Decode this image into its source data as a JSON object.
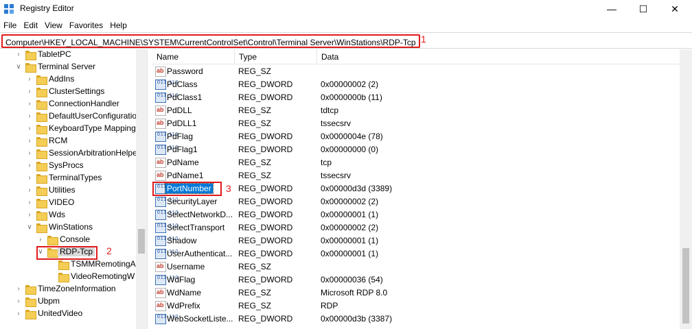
{
  "window": {
    "title": "Registry Editor",
    "controls": {
      "minimize": "—",
      "maximize": "☐",
      "close": "✕"
    }
  },
  "menu": [
    "File",
    "Edit",
    "View",
    "Favorites",
    "Help"
  ],
  "address": {
    "path": "Computer\\HKEY_LOCAL_MACHINE\\SYSTEM\\CurrentControlSet\\Control\\Terminal Server\\WinStations\\RDP-Tcp",
    "callout": "1"
  },
  "tree": {
    "items": [
      {
        "label": "TabletPC",
        "expanded": false,
        "selected": false
      },
      {
        "label": "Terminal Server",
        "expanded": true,
        "selected": false
      },
      {
        "label": "AddIns",
        "expanded": false,
        "selected": false
      },
      {
        "label": "ClusterSettings",
        "expanded": false,
        "selected": false
      },
      {
        "label": "ConnectionHandler",
        "expanded": false,
        "selected": false
      },
      {
        "label": "DefaultUserConfiguratio",
        "expanded": false,
        "selected": false
      },
      {
        "label": "KeyboardType Mapping",
        "expanded": false,
        "selected": false
      },
      {
        "label": "RCM",
        "expanded": false,
        "selected": false
      },
      {
        "label": "SessionArbitrationHelpe",
        "expanded": false,
        "selected": false
      },
      {
        "label": "SysProcs",
        "expanded": false,
        "selected": false
      },
      {
        "label": "TerminalTypes",
        "expanded": false,
        "selected": false
      },
      {
        "label": "Utilities",
        "expanded": false,
        "selected": false
      },
      {
        "label": "VIDEO",
        "expanded": false,
        "selected": false
      },
      {
        "label": "Wds",
        "expanded": false,
        "selected": false
      },
      {
        "label": "WinStations",
        "expanded": true,
        "selected": false
      },
      {
        "label": "Console",
        "expanded": false,
        "selected": false
      },
      {
        "label": "RDP-Tcp",
        "expanded": true,
        "selected": true
      },
      {
        "label": "TSMMRemotingA",
        "expanded": false,
        "selected": false
      },
      {
        "label": "VideoRemotingW",
        "expanded": false,
        "selected": false
      },
      {
        "label": "TimeZoneInformation",
        "expanded": false,
        "selected": false
      },
      {
        "label": "Ubpm",
        "expanded": false,
        "selected": false
      },
      {
        "label": "UnitedVideo",
        "expanded": false,
        "selected": false
      }
    ],
    "callout": "2"
  },
  "list": {
    "columns": [
      "Name",
      "Type",
      "Data"
    ],
    "rows": [
      {
        "name": "Password",
        "type": "REG_SZ",
        "data": "",
        "icon": "string-value-icon"
      },
      {
        "name": "PdClass",
        "type": "REG_DWORD",
        "data": "0x00000002 (2)",
        "icon": "binary-value-icon"
      },
      {
        "name": "PdClass1",
        "type": "REG_DWORD",
        "data": "0x0000000b (11)",
        "icon": "binary-value-icon"
      },
      {
        "name": "PdDLL",
        "type": "REG_SZ",
        "data": "tdtcp",
        "icon": "string-value-icon"
      },
      {
        "name": "PdDLL1",
        "type": "REG_SZ",
        "data": "tssecsrv",
        "icon": "string-value-icon"
      },
      {
        "name": "PdFlag",
        "type": "REG_DWORD",
        "data": "0x0000004e (78)",
        "icon": "binary-value-icon"
      },
      {
        "name": "PdFlag1",
        "type": "REG_DWORD",
        "data": "0x00000000 (0)",
        "icon": "binary-value-icon"
      },
      {
        "name": "PdName",
        "type": "REG_SZ",
        "data": "tcp",
        "icon": "string-value-icon"
      },
      {
        "name": "PdName1",
        "type": "REG_SZ",
        "data": "tssecsrv",
        "icon": "string-value-icon"
      },
      {
        "name": "PortNumber",
        "type": "REG_DWORD",
        "data": "0x00000d3d (3389)",
        "icon": "binary-value-icon",
        "selected": true
      },
      {
        "name": "SecurityLayer",
        "type": "REG_DWORD",
        "data": "0x00000002 (2)",
        "icon": "binary-value-icon"
      },
      {
        "name": "SelectNetworkD...",
        "type": "REG_DWORD",
        "data": "0x00000001 (1)",
        "icon": "binary-value-icon"
      },
      {
        "name": "SelectTransport",
        "type": "REG_DWORD",
        "data": "0x00000002 (2)",
        "icon": "binary-value-icon"
      },
      {
        "name": "Shadow",
        "type": "REG_DWORD",
        "data": "0x00000001 (1)",
        "icon": "binary-value-icon"
      },
      {
        "name": "UserAuthenticat...",
        "type": "REG_DWORD",
        "data": "0x00000001 (1)",
        "icon": "binary-value-icon"
      },
      {
        "name": "Username",
        "type": "REG_SZ",
        "data": "",
        "icon": "string-value-icon"
      },
      {
        "name": "WdFlag",
        "type": "REG_DWORD",
        "data": "0x00000036 (54)",
        "icon": "binary-value-icon"
      },
      {
        "name": "WdName",
        "type": "REG_SZ",
        "data": "Microsoft RDP 8.0",
        "icon": "string-value-icon"
      },
      {
        "name": "WdPrefix",
        "type": "REG_SZ",
        "data": "RDP",
        "icon": "string-value-icon"
      },
      {
        "name": "WebSocketListe...",
        "type": "REG_DWORD",
        "data": "0x00000d3b (3387)",
        "icon": "binary-value-icon"
      }
    ],
    "callout": "3"
  },
  "colors": {
    "annotation": "#e01a1a",
    "selection": "#0078d7",
    "folder": "#f4cd56"
  },
  "icons": {
    "string": "ab",
    "binary": "011 110"
  }
}
